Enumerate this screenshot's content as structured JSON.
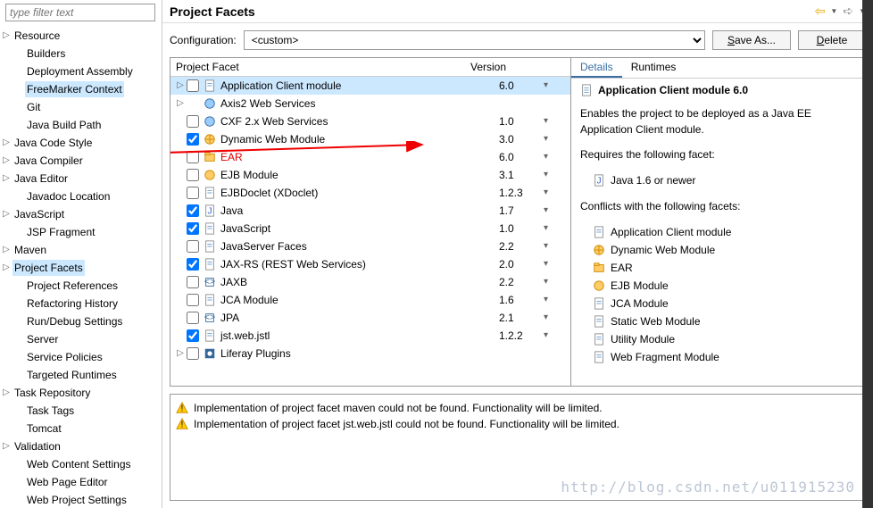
{
  "filter_placeholder": "type filter text",
  "tree": [
    {
      "label": "Resource",
      "caret": true
    },
    {
      "label": "Builders"
    },
    {
      "label": "Deployment Assembly"
    },
    {
      "label": "FreeMarker Context",
      "hl": true
    },
    {
      "label": "Git"
    },
    {
      "label": "Java Build Path"
    },
    {
      "label": "Java Code Style",
      "caret": true
    },
    {
      "label": "Java Compiler",
      "caret": true
    },
    {
      "label": "Java Editor",
      "caret": true
    },
    {
      "label": "Javadoc Location"
    },
    {
      "label": "JavaScript",
      "caret": true
    },
    {
      "label": "JSP Fragment"
    },
    {
      "label": "Maven",
      "caret": true
    },
    {
      "label": "Project Facets",
      "sel": true,
      "caret": true
    },
    {
      "label": "Project References"
    },
    {
      "label": "Refactoring History"
    },
    {
      "label": "Run/Debug Settings"
    },
    {
      "label": "Server"
    },
    {
      "label": "Service Policies"
    },
    {
      "label": "Targeted Runtimes"
    },
    {
      "label": "Task Repository",
      "caret": true
    },
    {
      "label": "Task Tags"
    },
    {
      "label": "Tomcat"
    },
    {
      "label": "Validation",
      "caret": true
    },
    {
      "label": "Web Content Settings"
    },
    {
      "label": "Web Page Editor"
    },
    {
      "label": "Web Project Settings"
    }
  ],
  "title": "Project Facets",
  "config_label": "Configuration:",
  "config_value": "<custom>",
  "saveas": "Save As...",
  "delete": "Delete",
  "col_facet": "Project Facet",
  "col_version": "Version",
  "facets": [
    {
      "caret": true,
      "cb": false,
      "name": "Application Client module",
      "ver": "6.0",
      "sel": true,
      "icon": "doc"
    },
    {
      "caret": true,
      "name": "Axis2 Web Services",
      "icon": "ws"
    },
    {
      "cb": false,
      "name": "CXF 2.x Web Services",
      "ver": "1.0",
      "icon": "ws"
    },
    {
      "cb": true,
      "name": "Dynamic Web Module",
      "ver": "3.0",
      "icon": "web"
    },
    {
      "cb": false,
      "name": "EAR",
      "ver": "6.0",
      "icon": "ear",
      "red": true
    },
    {
      "cb": false,
      "name": "EJB Module",
      "ver": "3.1",
      "icon": "ejb"
    },
    {
      "cb": false,
      "name": "EJBDoclet (XDoclet)",
      "ver": "1.2.3",
      "icon": "doc"
    },
    {
      "cb": true,
      "name": "Java",
      "ver": "1.7",
      "icon": "java"
    },
    {
      "cb": true,
      "name": "JavaScript",
      "ver": "1.0",
      "icon": "doc"
    },
    {
      "cb": false,
      "name": "JavaServer Faces",
      "ver": "2.2",
      "icon": "doc"
    },
    {
      "cb": true,
      "name": "JAX-RS (REST Web Services)",
      "ver": "2.0",
      "icon": "doc"
    },
    {
      "cb": false,
      "name": "JAXB",
      "ver": "2.2",
      "icon": "jaxb"
    },
    {
      "cb": false,
      "name": "JCA Module",
      "ver": "1.6",
      "icon": "doc"
    },
    {
      "cb": false,
      "name": "JPA",
      "ver": "2.1",
      "icon": "jpa"
    },
    {
      "cb": true,
      "name": "jst.web.jstl",
      "ver": "1.2.2",
      "icon": "doc"
    },
    {
      "caret": true,
      "cb": false,
      "name": "Liferay Plugins",
      "icon": "lr"
    }
  ],
  "tab_details": "Details",
  "tab_runtimes": "Runtimes",
  "detail_title": "Application Client module 6.0",
  "detail_desc": "Enables the project to be deployed as a Java EE Application Client module.",
  "requires_label": "Requires the following facet:",
  "requires": [
    {
      "label": "Java 1.6 or newer",
      "icon": "java"
    }
  ],
  "conflicts_label": "Conflicts with the following facets:",
  "conflicts": [
    {
      "label": "Application Client module",
      "icon": "doc"
    },
    {
      "label": "Dynamic Web Module",
      "icon": "web"
    },
    {
      "label": "EAR",
      "icon": "ear"
    },
    {
      "label": "EJB Module",
      "icon": "ejb"
    },
    {
      "label": "JCA Module",
      "icon": "doc"
    },
    {
      "label": "Static Web Module",
      "icon": "doc"
    },
    {
      "label": "Utility Module",
      "icon": "doc"
    },
    {
      "label": "Web Fragment Module",
      "icon": "doc"
    }
  ],
  "warnings": [
    "Implementation of project facet maven could not be found. Functionality will be limited.",
    "Implementation of project facet jst.web.jstl could not be found. Functionality will be limited."
  ],
  "watermark": "http://blog.csdn.net/u011915230"
}
